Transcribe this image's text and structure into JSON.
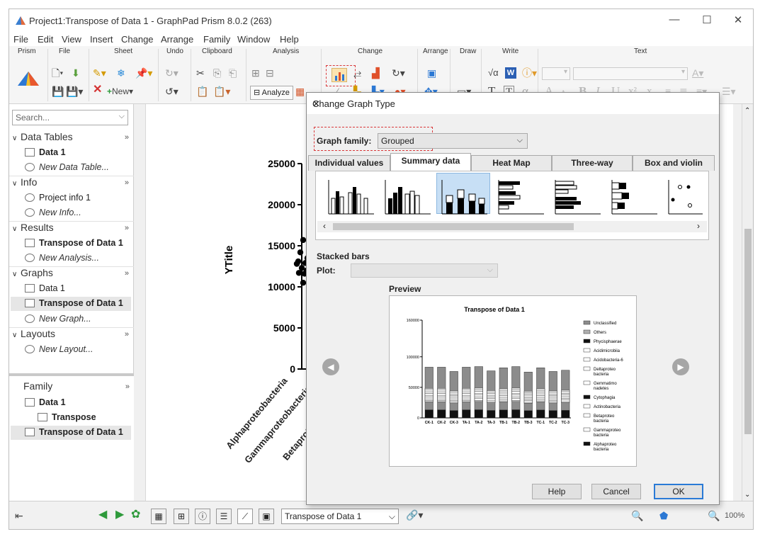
{
  "window": {
    "title": "Project1:Transpose of Data 1 - GraphPad Prism 8.0.2 (263)",
    "controls": [
      "—",
      "☐",
      "✕"
    ]
  },
  "menu": [
    "File",
    "Edit",
    "View",
    "Insert",
    "Change",
    "Arrange",
    "Family",
    "Window",
    "Help"
  ],
  "ribbon": {
    "groups": [
      "Prism",
      "File",
      "Sheet",
      "Undo",
      "Clipboard",
      "Analysis",
      "Change",
      "Arrange",
      "Draw",
      "Write",
      "Text"
    ],
    "new_label": "New",
    "analyze_label": "Analyze",
    "write_glyphs": [
      "√α",
      "W",
      "T",
      "T",
      "α"
    ],
    "text_glyphs": [
      "A",
      "A",
      "B",
      "I",
      "U",
      "x²",
      "x₂"
    ]
  },
  "navigator": {
    "search_placeholder": "Search...",
    "sections": [
      {
        "label": "Data Tables",
        "items": [
          "Data 1",
          "New Data Table..."
        ]
      },
      {
        "label": "Info",
        "items": [
          "Project info 1",
          "New Info..."
        ]
      },
      {
        "label": "Results",
        "items": [
          "Transpose of Data 1",
          "New Analysis..."
        ]
      },
      {
        "label": "Graphs",
        "items": [
          "Data 1",
          "Transpose of Data 1",
          "New Graph..."
        ]
      },
      {
        "label": "Layouts",
        "items": [
          "New Layout..."
        ]
      }
    ],
    "more_glyph": "»",
    "family": {
      "label": "Family",
      "items": [
        "Data 1",
        "Transpose",
        "Transpose of Data 1"
      ]
    }
  },
  "graph": {
    "ylabel": "YTitle",
    "yticks": [
      "25000",
      "20000",
      "15000",
      "10000",
      "5000",
      "0"
    ],
    "xticks": [
      "Alphaproteobacteria",
      "Gammaproteobacteria",
      "Betaproteobacteria"
    ]
  },
  "bottombar": {
    "sheet_select": "Transpose of Data 1",
    "zoom": "100%"
  },
  "dialog": {
    "title": "Change Graph Type",
    "graph_family_label": "Graph family:",
    "graph_family_value": "Grouped",
    "tabs": [
      "Individual values",
      "Summary data",
      "Heat Map",
      "Three-way",
      "Box and violin"
    ],
    "active_tab": "Summary data",
    "selected_type": "Stacked bars",
    "plot_label": "Plot:",
    "plot_value": "",
    "preview_label": "Preview",
    "buttons": {
      "help": "Help",
      "cancel": "Cancel",
      "ok": "OK"
    }
  },
  "chart_data": {
    "type": "bar",
    "title": "Transpose of Data 1",
    "categories": [
      "CK-1",
      "CK-2",
      "CK-3",
      "TA-1",
      "TA-2",
      "TA-3",
      "TB-1",
      "TB-2",
      "TB-3",
      "TC-1",
      "TC-2",
      "TC-3"
    ],
    "totals": [
      83000,
      83000,
      76000,
      83000,
      84000,
      77000,
      82000,
      84000,
      75000,
      82000,
      76000,
      78000
    ],
    "yticks": [
      "160000",
      "100000",
      "50000",
      "0"
    ],
    "ylim": [
      0,
      160000
    ],
    "legend": [
      "Unclassified",
      "Others",
      "Phycisphaerae",
      "Acidimicrobiia",
      "Acidobacteria-6",
      "Deltaproteobacteria",
      "Gemmatimonadetes",
      "Cytophagia",
      "Actinobacteria",
      "Betaproteobacteria",
      "Gammaproteobacteria",
      "Alphaproteobacteria"
    ],
    "legend_lines": [
      [
        "Unclassified"
      ],
      [
        "Others"
      ],
      [
        "Phycisphaerae"
      ],
      [
        "Acidimicrobiia"
      ],
      [
        "Acidobacteria-6"
      ],
      [
        "Deltaproteo",
        "bacteria"
      ],
      [
        "Gemmatimo",
        "nadetes"
      ],
      [
        "Cytophagia"
      ],
      [
        "Actinobacteria"
      ],
      [
        "Betaproteo",
        "bacteria"
      ],
      [
        "Gammaproteo",
        "bacteria"
      ],
      [
        "Alphaproteo",
        "bacteria"
      ]
    ],
    "legend_position": "right",
    "dot_plot": {
      "ylim": [
        0,
        25000
      ],
      "alphaproteobacteria_points": [
        15700,
        14200,
        13500,
        13100,
        12900,
        12600,
        12300,
        12000,
        11700,
        11600,
        12800,
        10500
      ]
    }
  },
  "colors": {
    "accent_red": "#d9383a",
    "selection_blue": "#c7dff5",
    "ok_border": "#2a7ad6"
  }
}
